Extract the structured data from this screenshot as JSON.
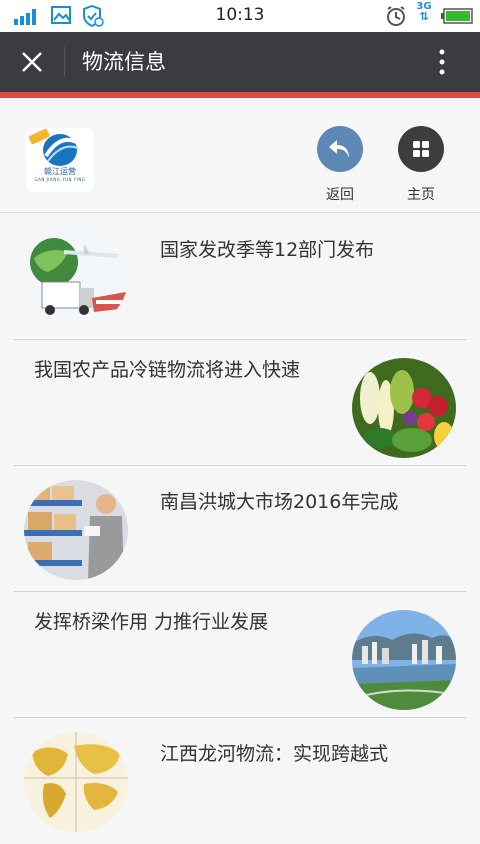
{
  "status": {
    "time": "10:13",
    "network": "3G",
    "icons": [
      "signal-icon",
      "gallery-icon",
      "shield-icon",
      "alarm-icon",
      "battery-icon"
    ]
  },
  "titlebar": {
    "title": "物流信息",
    "close_icon": "close-icon",
    "more_icon": "more-vertical-icon"
  },
  "header": {
    "logo_text": "赣江运营",
    "logo_sub": "GAN JIANG YUN YING",
    "back_label": "返回",
    "home_label": "主页"
  },
  "articles": [
    {
      "title": "国家发改季等12部门发布",
      "image": "logistics-globe-truck-plane"
    },
    {
      "title": "我国农产品冷链物流将进入快速",
      "image": "vegetables"
    },
    {
      "title": "南昌洪城大市场2016年完成",
      "image": "warehouse-worker"
    },
    {
      "title": "发挥桥梁作用 力推行业发展",
      "image": "city-river-skyline"
    },
    {
      "title": "江西龙河物流：实现跨越式",
      "image": "world-map"
    }
  ],
  "colors": {
    "titlebar_bg": "#3a3c41",
    "accent_red": "#e04a3f",
    "back_button": "#5d87b5",
    "home_button": "#3d3d3d"
  }
}
